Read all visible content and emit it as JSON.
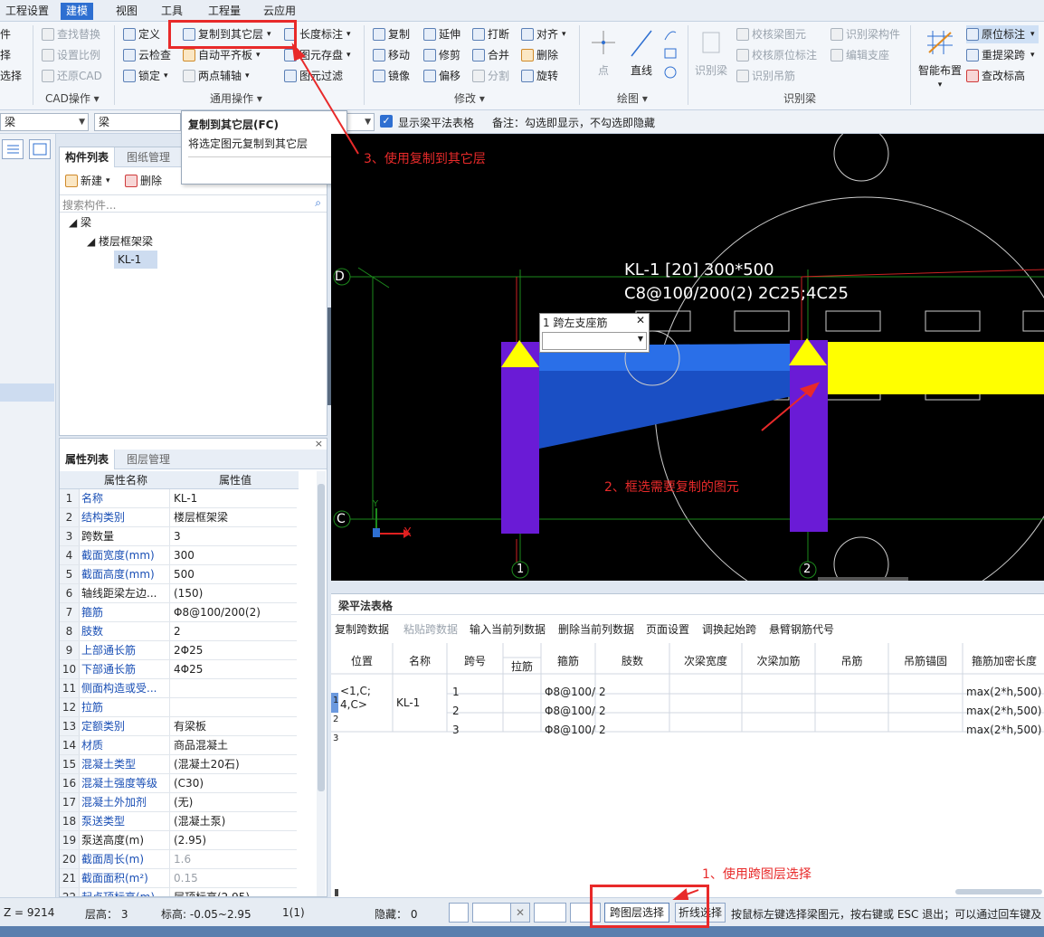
{
  "menu": [
    "工程设置",
    "建模",
    "视图",
    "工具",
    "工程量",
    "云应用"
  ],
  "ribbon": {
    "cad_items": [
      "查找替换",
      "设置比例",
      "还原CAD"
    ],
    "cad_left_cut": [
      "件",
      "择",
      "选择"
    ],
    "cad_group": "CAD操作",
    "general_items": [
      "定义",
      "复制到其它层",
      "长度标注",
      "云检查",
      "自动平齐板",
      "图元存盘",
      "锁定",
      "两点辅轴",
      "图元过滤"
    ],
    "general_group": "通用操作",
    "modify_items": [
      "复制",
      "延伸",
      "打断",
      "对齐",
      "移动",
      "修剪",
      "合并",
      "删除",
      "镜像",
      "偏移",
      "分割",
      "旋转"
    ],
    "modify_group": "修改",
    "draw_items": [
      "点",
      "直线"
    ],
    "draw_group": "绘图",
    "recog_items": [
      "识别梁",
      "校核梁图元",
      "识别梁构件",
      "校核原位标注",
      "编辑支座",
      "识别吊筋"
    ],
    "recog_group": "识别梁",
    "right_items": [
      "智能布置",
      "原位标注",
      "重提梁跨",
      "查改标高"
    ]
  },
  "tooltip": {
    "title": "复制到其它层(FC)",
    "desc": "将选定图元复制到其它层"
  },
  "row2": {
    "combo1": "梁",
    "combo2": "梁",
    "show_table_label": "显示梁平法表格",
    "note": "备注：勾选即显示，不勾选即隐藏"
  },
  "component_panel": {
    "tabs": [
      "构件列表",
      "图纸管理"
    ],
    "new_label": "新建",
    "delete_label": "删除",
    "search_placeholder": "搜索构件...",
    "tree": [
      "梁",
      "楼层框架梁",
      "KL-1"
    ]
  },
  "props_panel": {
    "tabs": [
      "属性列表",
      "图层管理"
    ],
    "headers": [
      "属性名称",
      "属性值"
    ],
    "rows": [
      {
        "n": "1",
        "k": "名称",
        "v": "KL-1",
        "blue": true
      },
      {
        "n": "2",
        "k": "结构类别",
        "v": "楼层框架梁",
        "blue": true
      },
      {
        "n": "3",
        "k": "跨数量",
        "v": "3",
        "blue": false
      },
      {
        "n": "4",
        "k": "截面宽度(mm)",
        "v": "300",
        "blue": true
      },
      {
        "n": "5",
        "k": "截面高度(mm)",
        "v": "500",
        "blue": true
      },
      {
        "n": "6",
        "k": "轴线距梁左边...",
        "v": "(150)",
        "blue": false
      },
      {
        "n": "7",
        "k": "箍筋",
        "v": "Φ8@100/200(2)",
        "blue": true
      },
      {
        "n": "8",
        "k": "肢数",
        "v": "2",
        "blue": true
      },
      {
        "n": "9",
        "k": "上部通长筋",
        "v": "2Φ25",
        "blue": true
      },
      {
        "n": "10",
        "k": "下部通长筋",
        "v": "4Φ25",
        "blue": true
      },
      {
        "n": "11",
        "k": "侧面构造或受...",
        "v": "",
        "blue": true
      },
      {
        "n": "12",
        "k": "拉筋",
        "v": "",
        "blue": true
      },
      {
        "n": "13",
        "k": "定额类别",
        "v": "有梁板",
        "blue": true
      },
      {
        "n": "14",
        "k": "材质",
        "v": "商品混凝土",
        "blue": true
      },
      {
        "n": "15",
        "k": "混凝土类型",
        "v": "(混凝土20石)",
        "blue": true
      },
      {
        "n": "16",
        "k": "混凝土强度等级",
        "v": "(C30)",
        "blue": true
      },
      {
        "n": "17",
        "k": "混凝土外加剂",
        "v": "(无)",
        "blue": true
      },
      {
        "n": "18",
        "k": "泵送类型",
        "v": "(混凝土泵)",
        "blue": true
      },
      {
        "n": "19",
        "k": "泵送高度(m)",
        "v": "(2.95)",
        "blue": false
      },
      {
        "n": "20",
        "k": "截面周长(m)",
        "v": "1.6",
        "blue": true,
        "gray": true
      },
      {
        "n": "21",
        "k": "截面面积(m²)",
        "v": "0.15",
        "blue": true,
        "gray": true
      },
      {
        "n": "22",
        "k": "起点顶标高(m)",
        "v": "层顶标高(2.95)",
        "blue": true
      }
    ]
  },
  "canvas": {
    "beam_label1": "KL-1 [20] 300*500",
    "beam_label2": "C8@100/200(2) 2C25;4C25",
    "popup_title": "1 跨左支座筋",
    "axis_D": "D",
    "axis_C": "C",
    "axis_1": "1",
    "axis_2": "2",
    "x_label": "X",
    "y_label": "Y"
  },
  "beam_table": {
    "title": "梁平法表格",
    "actions": [
      "复制跨数据",
      "粘贴跨数据",
      "输入当前列数据",
      "删除当前列数据",
      "页面设置",
      "调换起始跨",
      "悬臂钢筋代号"
    ],
    "headers": [
      "位置",
      "名称",
      "跨号",
      "拉筋",
      "箍筋",
      "肢数",
      "次梁宽度",
      "次梁加筋",
      "吊筋",
      "吊筋锚固",
      "箍筋加密长度"
    ],
    "position": "<1,C;\n4,C>",
    "name": "KL-1",
    "rows": [
      {
        "idx": "1",
        "span": "1",
        "stirrup": "Φ8@100/",
        "legs": "2",
        "dense": "max(2*h,500)"
      },
      {
        "idx": "2",
        "span": "2",
        "stirrup": "Φ8@100/",
        "legs": "2",
        "dense": "max(2*h,500)"
      },
      {
        "idx": "3",
        "span": "3",
        "stirrup": "Φ8@100/",
        "legs": "2",
        "dense": "max(2*h,500)"
      }
    ]
  },
  "status": {
    "z": "Z = 9214",
    "floor_h": "层高： 3",
    "elev": "标高: -0.05~2.95",
    "count": "1(1)",
    "hidden": "隐藏： 0",
    "cross_layer": "跨图层选择",
    "polyline": "折线选择",
    "hint": "按鼠标左键选择梁图元，按右键或 ESC 退出；可以通过回车键及"
  },
  "annotations": {
    "a1": "1、使用跨图层选择",
    "a2": "2、框选需要复制的图元",
    "a3": "3、使用复制到其它层"
  },
  "colors": {
    "accent": "#2e6fd1",
    "annotation": "#e82a2a",
    "beam_yellow": "#ffff00",
    "beam_blue": "#1f5fe0",
    "column_purple": "#6a1bd6"
  }
}
